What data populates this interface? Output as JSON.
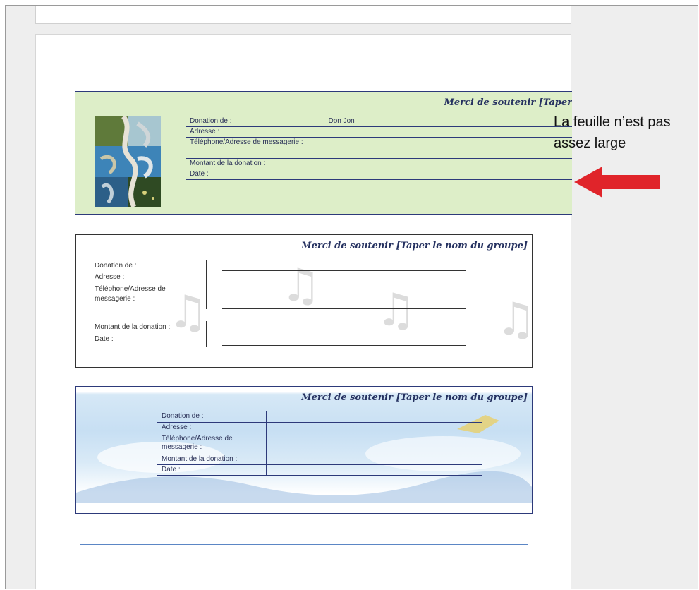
{
  "card1": {
    "title": "Merci de soutenir [Taper",
    "rows": [
      {
        "label": "Donation de :",
        "value": "Don Jon"
      },
      {
        "label": "Adresse :",
        "value": ""
      },
      {
        "label": "Téléphone/Adresse de messagerie :",
        "value": ""
      },
      {
        "label": "",
        "value": ""
      },
      {
        "label": "Montant de la donation :",
        "value": ""
      },
      {
        "label": "Date :",
        "value": ""
      }
    ]
  },
  "card2": {
    "title": "Merci de soutenir [Taper le nom du groupe]",
    "labels": {
      "donation": "Donation de :",
      "address": "Adresse :",
      "phone_line1": "Téléphone/Adresse de",
      "phone_line2": "messagerie :",
      "amount": "Montant de la donation :",
      "date": "Date :"
    }
  },
  "card3": {
    "title": "Merci de soutenir [Taper le nom du groupe]",
    "rows": [
      {
        "label": "Donation de :"
      },
      {
        "label": "Adresse :"
      },
      {
        "label": "Téléphone/Adresse de messagerie :"
      },
      {
        "label": "Montant de la donation :"
      },
      {
        "label": "Date :"
      }
    ]
  },
  "annotation": {
    "line1": "La feuille n’est pas",
    "line2": "assez large",
    "arrow_color": "#e0242a"
  },
  "icons": [
    "music-note-icon",
    "watercolor-art-image",
    "red-arrow-icon"
  ]
}
